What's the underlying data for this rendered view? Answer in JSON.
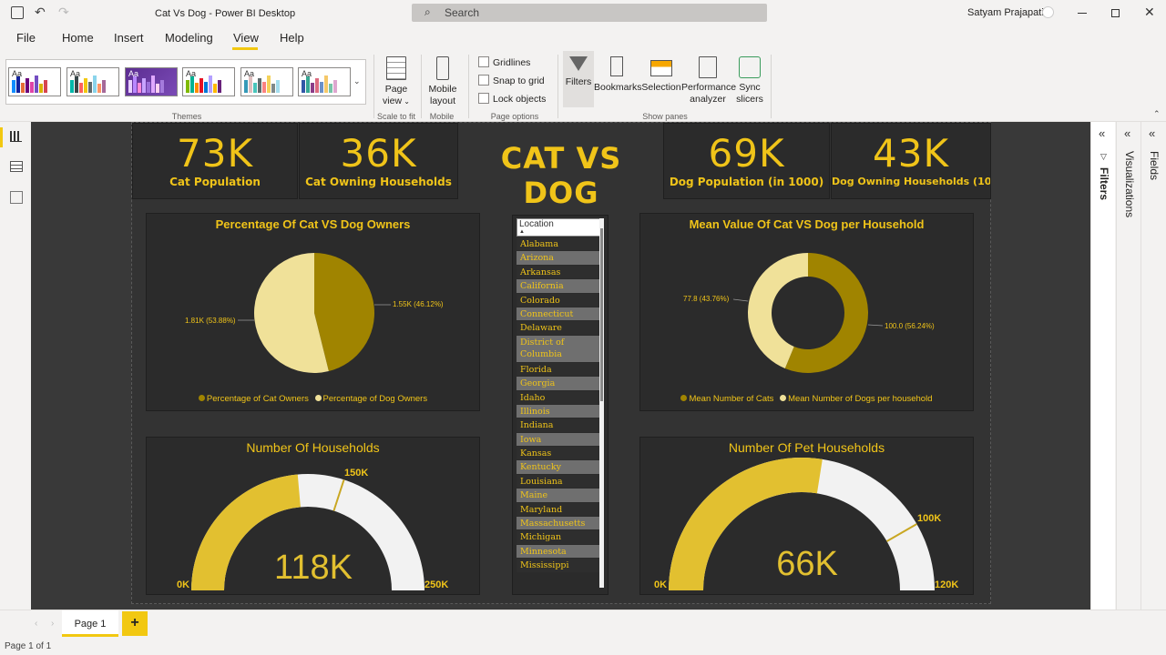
{
  "window": {
    "title": "Cat Vs Dog - Power BI Desktop",
    "search_placeholder": "Search",
    "user": "Satyam Prajapati"
  },
  "ribbon": {
    "tabs": [
      "File",
      "Home",
      "Insert",
      "Modeling",
      "View",
      "Help"
    ],
    "active_tab": "View",
    "groups": {
      "themes": "Themes",
      "scale": "Scale to fit",
      "mobile": "Mobile",
      "page_options": "Page options",
      "show_panes": "Show panes"
    },
    "page_view": "Page view",
    "mobile_layout": "Mobile layout",
    "gridlines": "Gridlines",
    "snap": "Snap to grid",
    "lock": "Lock objects",
    "filters": "Filters",
    "bookmarks": "Bookmarks",
    "selection": "Selection",
    "performance": "Performance analyzer",
    "sync": "Sync slicers",
    "theme_aa": "Aa"
  },
  "report": {
    "kpis": [
      {
        "value": "73K",
        "label": "Cat Population"
      },
      {
        "value": "36K",
        "label": "Cat Owning Households"
      },
      {
        "value": "69K",
        "label": "Dog Population (in 1000)"
      },
      {
        "value": "43K",
        "label": "Dog Owning Households (10..."
      }
    ],
    "main_title": "CAT VS DOG",
    "pie": {
      "title": "Percentage Of Cat VS Dog Owners",
      "label_cat": "1.55K (46.12%)",
      "label_dog": "1.81K (53.88%)",
      "legend_cat": "Percentage of Cat Owners",
      "legend_dog": "Percentage of Dog Owners"
    },
    "donut": {
      "title": "Mean Value Of Cat VS Dog per Household",
      "label_cat": "100.0 (56.24%)",
      "label_dog": "77.8 (43.76%)",
      "legend_cat": "Mean Number of Cats",
      "legend_dog": "Mean Number of Dogs per household"
    },
    "gauge1": {
      "title": "Number Of Households",
      "value": "118K",
      "min": "0K",
      "max": "250K",
      "target": "150K"
    },
    "gauge2": {
      "title": "Number Of Pet Households",
      "value": "66K",
      "min": "0K",
      "max": "120K",
      "target": "100K"
    },
    "slicer": {
      "header": "Location",
      "items": [
        "Alabama",
        "Arizona",
        "Arkansas",
        "California",
        "Colorado",
        "Connecticut",
        "Delaware",
        "District of Columbia",
        "Florida",
        "Georgia",
        "Idaho",
        "Illinois",
        "Indiana",
        "Iowa",
        "Kansas",
        "Kentucky",
        "Louisiana",
        "Maine",
        "Maryland",
        "Massachusetts",
        "Michigan",
        "Minnesota",
        "Mississippi"
      ]
    }
  },
  "panes": {
    "filters": "Filters",
    "visualizations": "Visualizations",
    "fields": "Fields"
  },
  "pages": {
    "tab": "Page 1",
    "add": "+",
    "status": "Page 1 of 1"
  },
  "colors": {
    "accent": "#f0c419",
    "cat": "#a08400",
    "dog": "#f0e199",
    "canvas": "#333333"
  },
  "chart_data": [
    {
      "type": "pie",
      "title": "Percentage Of Cat VS Dog Owners",
      "categories": [
        "Percentage of Cat Owners",
        "Percentage of Dog Owners"
      ],
      "values": [
        1550,
        1810
      ],
      "percent": [
        46.12,
        53.88
      ]
    },
    {
      "type": "pie",
      "title": "Mean Value Of Cat VS Dog per Household",
      "categories": [
        "Mean Number of Cats",
        "Mean Number of Dogs per household"
      ],
      "values": [
        100.0,
        77.8
      ],
      "percent": [
        56.24,
        43.76
      ]
    },
    {
      "type": "gauge",
      "title": "Number Of Households",
      "value": 118000,
      "min": 0,
      "max": 250000,
      "target": 150000
    },
    {
      "type": "gauge",
      "title": "Number Of Pet Households",
      "value": 66000,
      "min": 0,
      "max": 120000,
      "target": 100000
    }
  ]
}
